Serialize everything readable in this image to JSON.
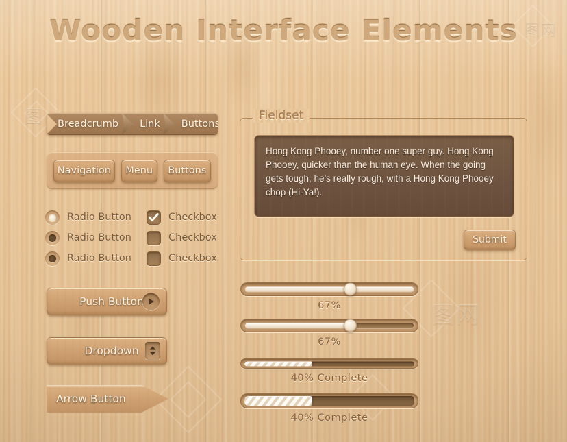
{
  "page": {
    "title": "Wooden Interface Elements",
    "accent_wood_light": "#e9c79c",
    "accent_wood_mid": "#d0a273",
    "accent_wood_dark": "#6e5440",
    "text_carved": "#8a6039",
    "text_raised": "#fdf3e4"
  },
  "breadcrumb": {
    "items": [
      {
        "label": "Breadcrumb"
      },
      {
        "label": "Link"
      },
      {
        "label": "Buttons"
      }
    ]
  },
  "navbar": {
    "items": [
      {
        "label": "Navigation"
      },
      {
        "label": "Menu"
      },
      {
        "label": "Buttons"
      }
    ]
  },
  "radios": [
    {
      "label": "Radio Button",
      "checked": true
    },
    {
      "label": "Radio Button",
      "checked": false
    },
    {
      "label": "Radio Button",
      "checked": false
    }
  ],
  "checkboxes": [
    {
      "label": "Checkbox",
      "checked": true
    },
    {
      "label": "Checkbox",
      "checked": false
    },
    {
      "label": "Checkbox",
      "checked": false
    }
  ],
  "buttons": {
    "push": {
      "label": "Push Button",
      "icon": "play-triangle-icon"
    },
    "dropdown": {
      "label": "Dropdown",
      "icon": "updown-arrows-icon"
    },
    "arrow": {
      "label": "Arrow Button"
    }
  },
  "fieldset": {
    "legend": "Fieldset",
    "textarea_value": "Hong Kong Phooey, number one super guy. Hong Kong Phooey, quicker than the human eye. When the going gets tough, he's really rough, with a Hong Kong Phooey chop (Hi-Ya!).",
    "submit_label": "Submit"
  },
  "sliders": [
    {
      "name": "slider-1",
      "value": 67,
      "label": "67%",
      "fill_visible": false,
      "handle_pct": 62
    },
    {
      "name": "slider-2",
      "value": 67,
      "label": "67%",
      "fill_visible": true,
      "handle_pct": 62
    }
  ],
  "progress_bars": [
    {
      "name": "progress-1",
      "value": 40,
      "label": "40% Complete"
    },
    {
      "name": "progress-2",
      "value": 40,
      "label": "40% Complete"
    }
  ],
  "watermarks": {
    "left": "图",
    "right": "图网"
  }
}
